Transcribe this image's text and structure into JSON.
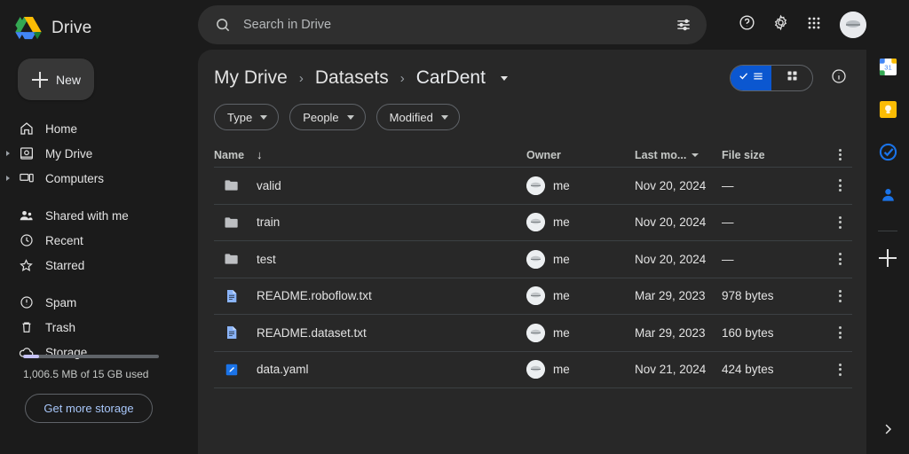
{
  "app": {
    "name": "Drive",
    "logo_colors": {
      "blue": "#1a73e8",
      "green": "#34a853",
      "yellow": "#fbbc04"
    }
  },
  "sidebar": {
    "new_button": "New",
    "primary": [
      {
        "label": "Home",
        "icon": "home-icon",
        "expandable": false
      },
      {
        "label": "My Drive",
        "icon": "my-drive-icon",
        "expandable": true
      },
      {
        "label": "Computers",
        "icon": "computers-icon",
        "expandable": true
      }
    ],
    "secondary": [
      {
        "label": "Shared with me",
        "icon": "people-icon",
        "expandable": false
      },
      {
        "label": "Recent",
        "icon": "clock-icon",
        "expandable": false
      },
      {
        "label": "Starred",
        "icon": "star-icon",
        "expandable": false
      }
    ],
    "tertiary": [
      {
        "label": "Spam",
        "icon": "spam-icon",
        "expandable": false
      },
      {
        "label": "Trash",
        "icon": "trash-icon",
        "expandable": false
      },
      {
        "label": "Storage",
        "icon": "cloud-icon",
        "expandable": false
      }
    ],
    "storage": {
      "used_text": "1,006.5 MB of 15 GB used",
      "percent": 6.7,
      "cta": "Get more storage",
      "bar_color": "#c5c2f5",
      "cta_color": "#a8c7fa"
    }
  },
  "search": {
    "placeholder": "Search in Drive",
    "value": "",
    "icon": "search-icon",
    "filter_icon": "tune-icon"
  },
  "topbar_actions": [
    {
      "name": "help-icon"
    },
    {
      "name": "settings-gear-icon"
    },
    {
      "name": "apps-grid-icon"
    },
    {
      "name": "account-avatar"
    }
  ],
  "breadcrumb": {
    "items": [
      "My Drive",
      "Datasets",
      "CarDent"
    ],
    "separator": "›",
    "has_caret": true
  },
  "view": {
    "list_label": "list-view",
    "grid_label": "grid-view",
    "active": "list-view",
    "active_color": "#0b57d0",
    "info_label": "details"
  },
  "filters": [
    {
      "label": "Type"
    },
    {
      "label": "People"
    },
    {
      "label": "Modified"
    }
  ],
  "table": {
    "columns": {
      "name": "Name",
      "owner": "Owner",
      "modified": "Last mo...",
      "size": "File size"
    },
    "sort_arrow": "↓",
    "rows": [
      {
        "name": "valid",
        "type": "folder",
        "owner": "me",
        "modified": "Nov 20, 2024",
        "size": "—"
      },
      {
        "name": "train",
        "type": "folder",
        "owner": "me",
        "modified": "Nov 20, 2024",
        "size": "—"
      },
      {
        "name": "test",
        "type": "folder",
        "owner": "me",
        "modified": "Nov 20, 2024",
        "size": "—"
      },
      {
        "name": "README.roboflow.txt",
        "type": "text",
        "owner": "me",
        "modified": "Mar 29, 2023",
        "size": "978 bytes"
      },
      {
        "name": "README.dataset.txt",
        "type": "text",
        "owner": "me",
        "modified": "Mar 29, 2023",
        "size": "160 bytes"
      },
      {
        "name": "data.yaml",
        "type": "yaml",
        "owner": "me",
        "modified": "Nov 21, 2024",
        "size": "424 bytes"
      }
    ]
  },
  "right_rail": {
    "items": [
      {
        "name": "google-calendar-icon"
      },
      {
        "name": "google-keep-icon"
      },
      {
        "name": "google-tasks-icon"
      },
      {
        "name": "google-contacts-icon"
      }
    ],
    "add_label": "add-ons-plus",
    "expand_label": "expand-panel"
  }
}
